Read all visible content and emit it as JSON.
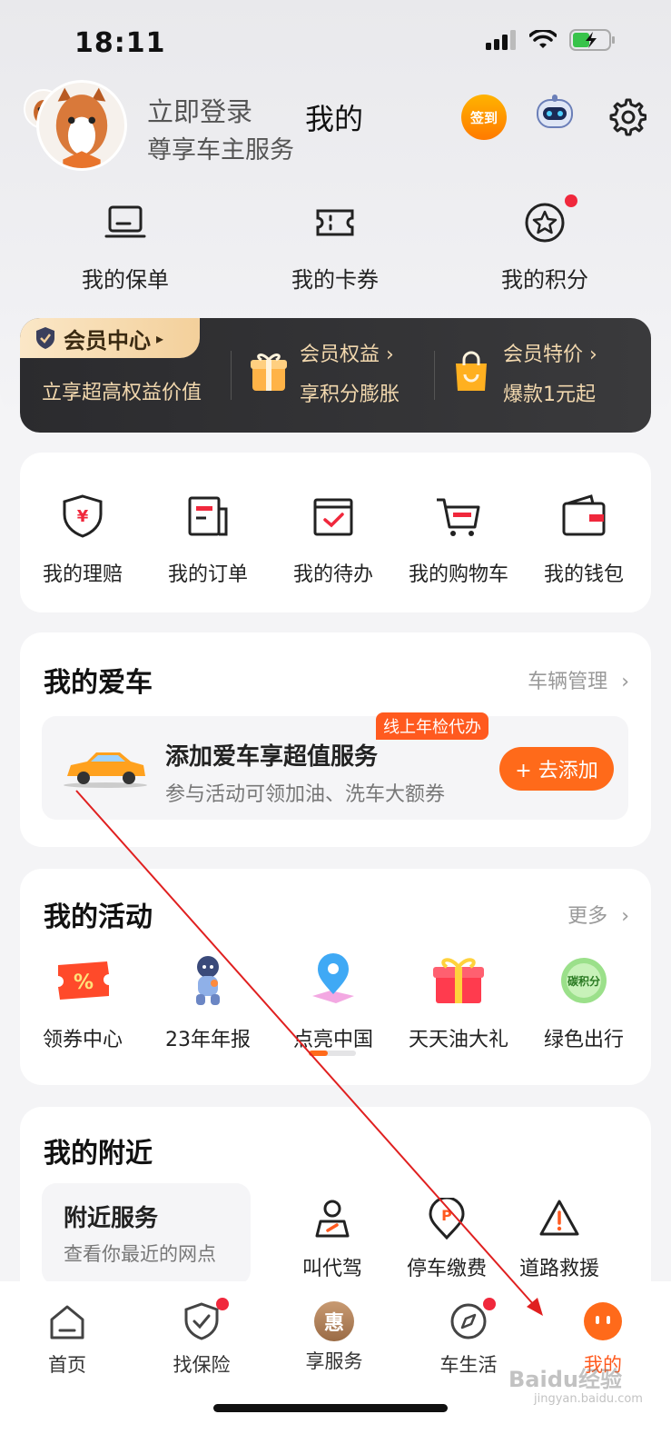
{
  "status_bar": {
    "time": "18:11"
  },
  "header": {
    "login_label": "立即登录",
    "login_subtitle": "尊享车主服务",
    "title": "我的",
    "signin_label": "签到"
  },
  "quick_links": [
    {
      "label": "我的保单",
      "icon": "policy-icon"
    },
    {
      "label": "我的卡券",
      "icon": "coupon-icon"
    },
    {
      "label": "我的积分",
      "icon": "points-icon"
    }
  ],
  "member": {
    "badge": "会员中心",
    "subtitle": "立享超高权益价值",
    "benefits_title": "会员权益 ›",
    "benefits_sub": "享积分膨胀",
    "deals_title": "会员特价 ›",
    "deals_sub": "爆款1元起"
  },
  "services": [
    {
      "label": "我的理赔",
      "icon": "claim-icon"
    },
    {
      "label": "我的订单",
      "icon": "order-icon"
    },
    {
      "label": "我的待办",
      "icon": "todo-icon"
    },
    {
      "label": "我的购物车",
      "icon": "cart-icon"
    },
    {
      "label": "我的钱包",
      "icon": "wallet-icon"
    }
  ],
  "my_car": {
    "title": "我的爱车",
    "manage_label": "车辆管理",
    "tag": "线上年检代办",
    "promo_title": "添加爱车享超值服务",
    "promo_subtitle": "参与活动可领加油、洗车大额券",
    "add_button": "+ 去添加"
  },
  "activities": {
    "title": "我的活动",
    "more_label": "更多",
    "items": [
      {
        "label": "领券中心",
        "icon": "coupon-center-icon"
      },
      {
        "label": "23年年报",
        "icon": "annual-report-icon"
      },
      {
        "label": "点亮中国",
        "icon": "map-pin-icon"
      },
      {
        "label": "天天油大礼",
        "icon": "gift-icon"
      },
      {
        "label": "绿色出行",
        "icon": "carbon-points-icon",
        "badge": "碳积分"
      }
    ],
    "scroll_progress": 0.4
  },
  "nearby": {
    "title": "我的附近",
    "box_title": "附近服务",
    "box_subtitle": "查看你最近的网点",
    "items": [
      {
        "label": "叫代驾",
        "icon": "driver-icon"
      },
      {
        "label": "停车缴费",
        "icon": "parking-icon"
      },
      {
        "label": "道路救援",
        "icon": "warning-icon"
      }
    ]
  },
  "tabbar": [
    {
      "label": "首页",
      "icon": "home-icon"
    },
    {
      "label": "找保险",
      "icon": "shield-check-icon"
    },
    {
      "label": "享服务",
      "icon": "hui-icon",
      "glyph": "惠"
    },
    {
      "label": "车生活",
      "icon": "compass-icon"
    },
    {
      "label": "我的",
      "icon": "profile-face-icon",
      "active": true
    }
  ],
  "watermark": {
    "brand": "Baidu经验",
    "url": "jingyan.baidu.com"
  },
  "colors": {
    "accent": "#ff6a1a",
    "badge_red": "#f0283c",
    "member_bg": "#2b2b2e",
    "gold": "#f2d8ae"
  }
}
